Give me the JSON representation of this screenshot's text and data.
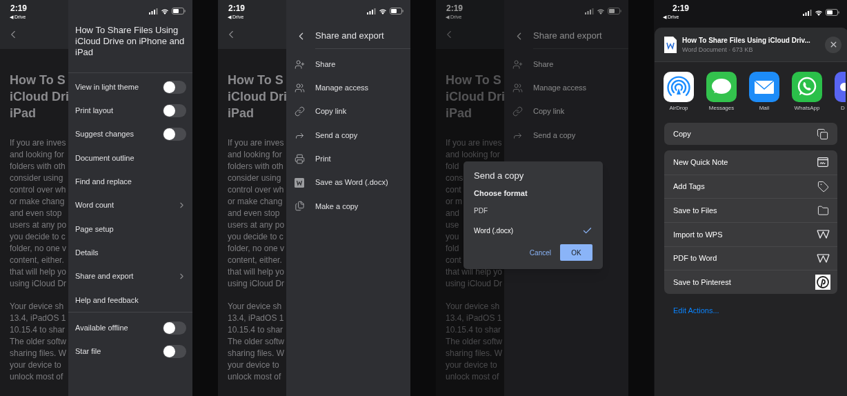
{
  "screens": [
    {
      "kind": "settings",
      "status": {
        "time": "2:19",
        "back": "◀ Drive"
      },
      "doc": {
        "heading": [
          "How To S",
          "iCloud Dri",
          "iPad"
        ],
        "paragraphs": [
          [
            "If you are inves",
            "and looking for",
            "folders with oth",
            "consider using",
            "control over wh",
            "or make chang",
            "and even stop",
            "users at any po",
            "you decide to c",
            "folder, no one v",
            "content, either.",
            "that will help yo",
            "using iCloud Dr"
          ],
          [
            "Your device sh",
            "13.4, iPadOS 1",
            "10.15.4 to shar",
            "The older softw",
            "sharing files. W",
            "your device to",
            "unlock most of"
          ]
        ]
      },
      "menu": {
        "title": "How To Share Files Using iCloud Drive on iPhone and iPad",
        "sections": [
          [
            {
              "label": "View in light theme",
              "kind": "toggle",
              "on": false
            },
            {
              "label": "Print layout",
              "kind": "toggle",
              "on": false
            },
            {
              "label": "Suggest changes",
              "kind": "toggle",
              "on": false
            },
            {
              "label": "Document outline",
              "kind": "plain"
            },
            {
              "label": "Find and replace",
              "kind": "plain"
            },
            {
              "label": "Word count",
              "kind": "submenu"
            },
            {
              "label": "Page setup",
              "kind": "plain"
            },
            {
              "label": "Details",
              "kind": "plain"
            },
            {
              "label": "Share and export",
              "kind": "submenu"
            },
            {
              "label": "Help and feedback",
              "kind": "plain"
            }
          ],
          [
            {
              "label": "Available offline",
              "kind": "toggle",
              "on": false
            },
            {
              "label": "Star file",
              "kind": "toggle",
              "on": false
            }
          ]
        ]
      }
    },
    {
      "kind": "share_menu",
      "status": {
        "time": "2:19",
        "back": "◀ Drive"
      },
      "doc": {
        "heading": [
          "How To S",
          "iCloud Dri",
          "iPad"
        ],
        "paragraphs": [
          [
            "If you are inves",
            "and looking for",
            "folders with oth",
            "consider using",
            "control over wh",
            "or make chang",
            "and even stop",
            "users at any po",
            "you decide to c",
            "folder, no one v",
            "content, either.",
            "that will help yo",
            "using iCloud Dr"
          ],
          [
            "Your device sh",
            "13.4, iPadOS 1",
            "10.15.4 to shar",
            "The older softw",
            "sharing files. W",
            "your device to",
            "unlock most of"
          ]
        ]
      },
      "menu": {
        "title": "Share and export",
        "items": [
          {
            "label": "Share",
            "kind": "share"
          },
          {
            "label": "Manage access",
            "kind": "access"
          },
          {
            "label": "Copy link",
            "kind": "link"
          },
          {
            "label": "Send a copy",
            "kind": "send"
          },
          {
            "label": "Print",
            "kind": "print"
          },
          {
            "label": "Save as Word (.docx)",
            "kind": "word"
          },
          {
            "label": "Make a copy",
            "kind": "copy"
          }
        ]
      }
    },
    {
      "kind": "share_menu",
      "status": {
        "time": "2:19",
        "back": "◀ Drive"
      },
      "doc": {
        "heading": [
          "How To S",
          "iCloud Dri",
          "iPad"
        ],
        "paragraphs": [
          [
            "If you are inves",
            "and looking for",
            "fold",
            "cons",
            "cont",
            "or m",
            "and",
            "use",
            "you",
            "fold",
            "cont",
            "that will help yo",
            "using iCloud Dr"
          ],
          [
            "Your device sh",
            "13.4, iPadOS 1",
            "10.15.4 to shar",
            "The older softw",
            "sharing files. W",
            "your device to",
            "unlock most of"
          ]
        ]
      },
      "menu": {
        "title": "Share and export",
        "items": [
          {
            "label": "Share",
            "kind": "share"
          },
          {
            "label": "Manage access",
            "kind": "access"
          },
          {
            "label": "Copy link",
            "kind": "link"
          },
          {
            "label": "Send a copy",
            "kind": "send"
          }
        ]
      },
      "dialog": {
        "title": "Send a copy",
        "subtitle": "Choose format",
        "options": [
          {
            "label": "PDF",
            "selected": false
          },
          {
            "label": "Word (.docx)",
            "selected": true
          }
        ],
        "cancel": "Cancel",
        "ok": "OK"
      }
    },
    {
      "kind": "share_sheet",
      "status": {
        "time": "2:19",
        "back": "◀ Drive"
      },
      "file": {
        "title": "How To Share Files Using iCloud Driv...",
        "subtitle": "Word Document · 673 KB"
      },
      "apps": [
        {
          "label": "AirDrop",
          "kind": "airdrop"
        },
        {
          "label": "Messages",
          "kind": "messages"
        },
        {
          "label": "Mail",
          "kind": "mail"
        },
        {
          "label": "WhatsApp",
          "kind": "whatsapp"
        },
        {
          "label": "D",
          "kind": "partial"
        }
      ],
      "copy": "Copy",
      "actions": [
        {
          "label": "New Quick Note",
          "kind": "note"
        },
        {
          "label": "Add Tags",
          "kind": "tag"
        },
        {
          "label": "Save to Files",
          "kind": "folder"
        },
        {
          "label": "Import to WPS",
          "kind": "wps"
        },
        {
          "label": "PDF to Word",
          "kind": "wps"
        },
        {
          "label": "Save to Pinterest",
          "kind": "pinterest"
        }
      ],
      "edit": "Edit Actions..."
    }
  ]
}
